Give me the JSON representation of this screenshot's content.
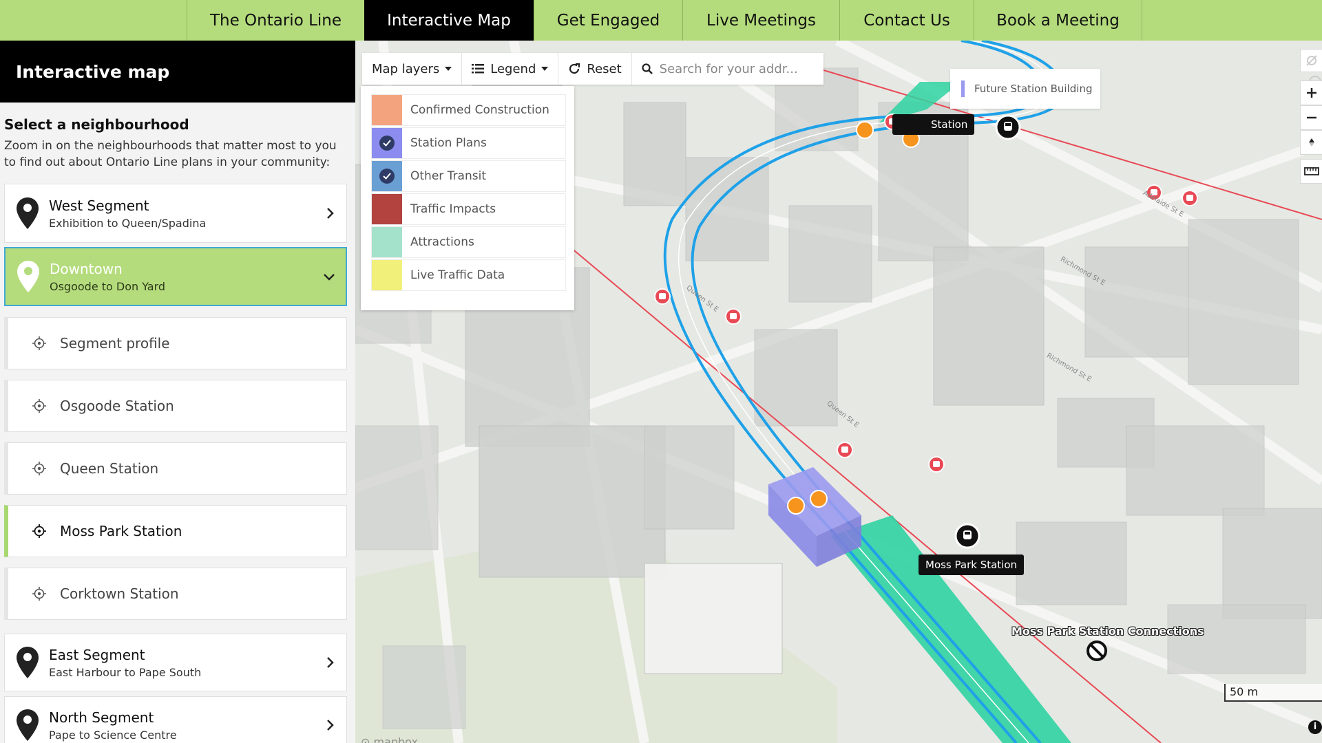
{
  "nav": {
    "tabs": [
      {
        "label": "The Ontario Line"
      },
      {
        "label": "Interactive Map"
      },
      {
        "label": "Get Engaged"
      },
      {
        "label": "Live Meetings"
      },
      {
        "label": "Contact Us"
      },
      {
        "label": "Book a Meeting"
      }
    ],
    "active": "Interactive Map"
  },
  "sidebar": {
    "title": "Interactive map",
    "subtitle": "Select a neighbourhood",
    "intro": "Zoom in on the neighbourhoods that matter most to you to find out about Ontario Line plans in your community:",
    "segments": [
      {
        "name": "West Segment",
        "range": "Exhibition to Queen/Spadina"
      },
      {
        "name": "Downtown",
        "range": "Osgoode to Don Yard"
      },
      {
        "name": "East Segment",
        "range": "East Harbour to Pape South"
      },
      {
        "name": "North Segment",
        "range": "Pape to Science Centre"
      }
    ],
    "downtown_items": [
      {
        "label": "Segment profile"
      },
      {
        "label": "Osgoode Station"
      },
      {
        "label": "Queen Station"
      },
      {
        "label": "Moss Park Station"
      },
      {
        "label": "Corktown Station"
      }
    ],
    "active_item": "Moss Park Station"
  },
  "toolbar": {
    "map_layers": "Map layers",
    "legend": "Legend",
    "reset": "Reset",
    "search_placeholder": "Search for your addr..."
  },
  "legend": {
    "items": [
      {
        "label": "Confirmed Construction",
        "color": "#f4a37f",
        "checked": false
      },
      {
        "label": "Station Plans",
        "color": "#8c8cf0",
        "checked": true
      },
      {
        "label": "Other Transit",
        "color": "#6a9fd4",
        "checked": true
      },
      {
        "label": "Traffic Impacts",
        "color": "#b2433f",
        "checked": false
      },
      {
        "label": "Attractions",
        "color": "#a4e2cc",
        "checked": false
      },
      {
        "label": "Live Traffic Data",
        "color": "#f1f07a",
        "checked": false
      }
    ]
  },
  "map": {
    "future_station_tooltip": "Future Station Building",
    "upper_station_label": "Station",
    "moss_park_label": "Moss Park Station",
    "connections_label": "Moss Park Station Connections",
    "scale": "50 m",
    "street_labels": [
      "Queen St E",
      "Richmond St E",
      "Adelaide St E"
    ],
    "colors": {
      "accent_green": "#b4dc7c",
      "line_blue": "#1ea1e8",
      "corridor_green": "#2fd3a2",
      "streetcar_red": "#e84a55",
      "stop_orange": "#f7941d"
    }
  }
}
